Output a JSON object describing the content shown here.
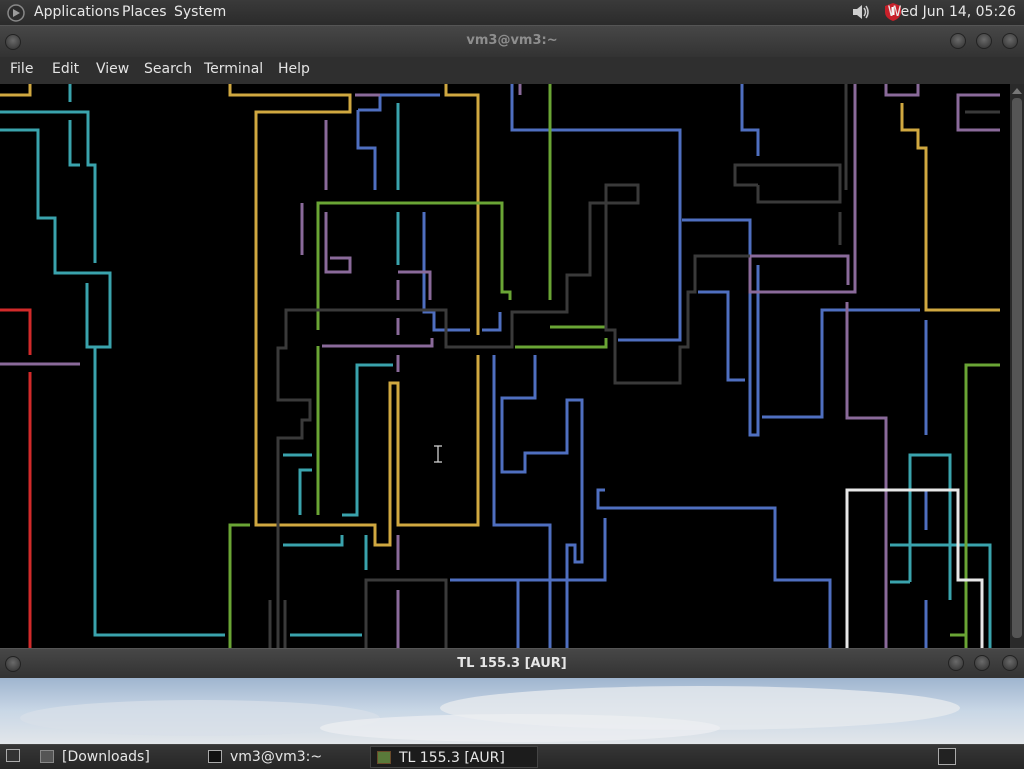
{
  "top_panel": {
    "menus": [
      "Applications",
      "Places",
      "System"
    ],
    "clock": "Wed Jun 14, 05:26",
    "tray_icons": [
      "volume-icon",
      "shield-icon"
    ]
  },
  "terminal_window": {
    "title": "vm3@vm3:~",
    "menu": [
      "File",
      "Edit",
      "View",
      "Search",
      "Terminal",
      "Help"
    ]
  },
  "second_window": {
    "title": "TL 155.3 [AUR]"
  },
  "taskbar": {
    "items": [
      {
        "label": "[Downloads]",
        "icon": "folder-icon",
        "active": false
      },
      {
        "label": "vm3@vm3:~",
        "icon": "terminal-icon",
        "active": false
      },
      {
        "label": "TL 155.3 [AUR]",
        "icon": "game-icon",
        "active": true
      }
    ]
  },
  "colors": {
    "cyan": "#3aa3ad",
    "blue": "#4f6fc0",
    "purple": "#8a6a9a",
    "yellow": "#d0a840",
    "green": "#6aa535",
    "red": "#d22a2a",
    "gray": "#3a3a3a",
    "white": "#e8e8e8"
  }
}
